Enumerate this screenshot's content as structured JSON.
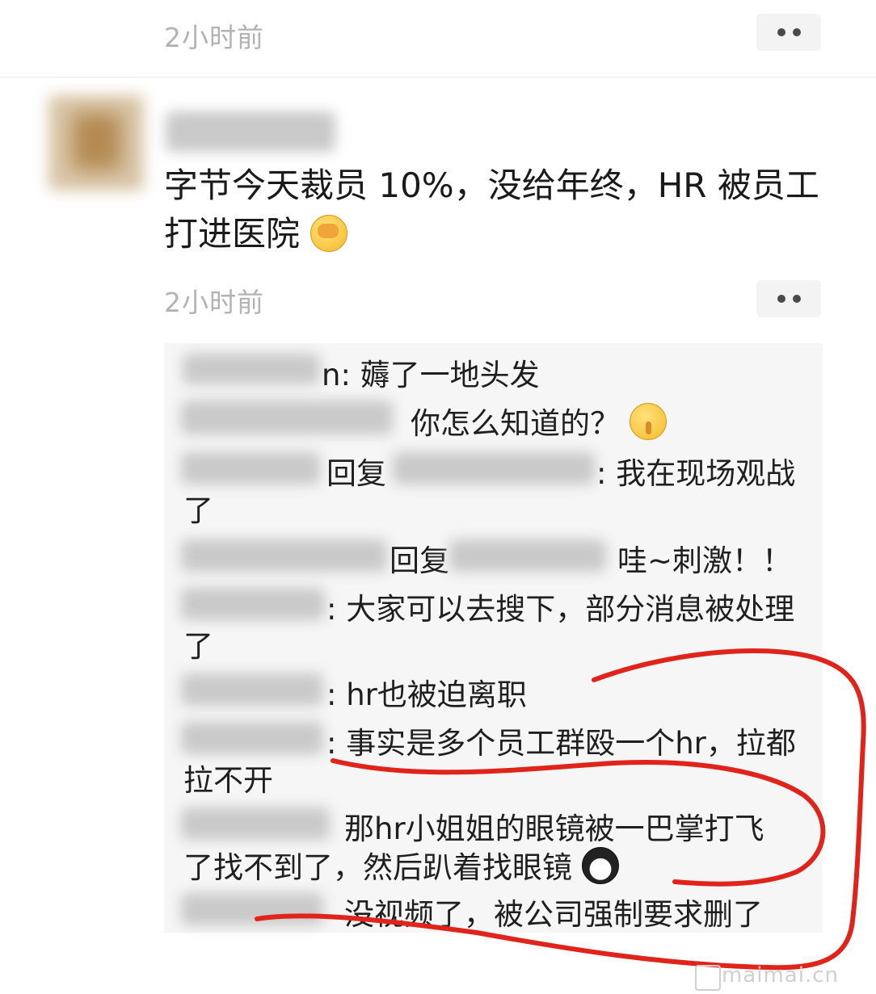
{
  "posts": [
    {
      "time": "2小时前"
    },
    {
      "time": "2小时前",
      "text_line1": "字节今天裁员 10%，没给年终，HR 被员工",
      "text_line2": "打进医院",
      "emoji": "facepalm-emoji"
    }
  ],
  "comments": [
    {
      "tail": "n: 薅了一地头发"
    },
    {
      "text": "你怎么知道的？",
      "emoji": "shush-emoji"
    },
    {
      "reply": "回复",
      "text": ": 我在现场观战",
      "cont": "了"
    },
    {
      "reply": "回复",
      "text": "哇~刺激！！"
    },
    {
      "text": ": 大家可以去搜下，部分消息被处理",
      "cont": "了"
    },
    {
      "text": ": hr也被迫离职"
    },
    {
      "text": ": 事实是多个员工群殴一个hr，拉都",
      "cont": "拉不开"
    },
    {
      "text": "那hr小姐姐的眼镜被一巴掌打飞",
      "cont": "了找不到了，然后趴着找眼镜",
      "emoji": "penguin-emoji"
    },
    {
      "text": "没视频了，被公司强制要求删了"
    }
  ],
  "watermark": "maimai.cn",
  "colors": {
    "annotation": "#e0241b",
    "time": "#b3b3b3",
    "comment_bg": "#f6f6f6"
  }
}
